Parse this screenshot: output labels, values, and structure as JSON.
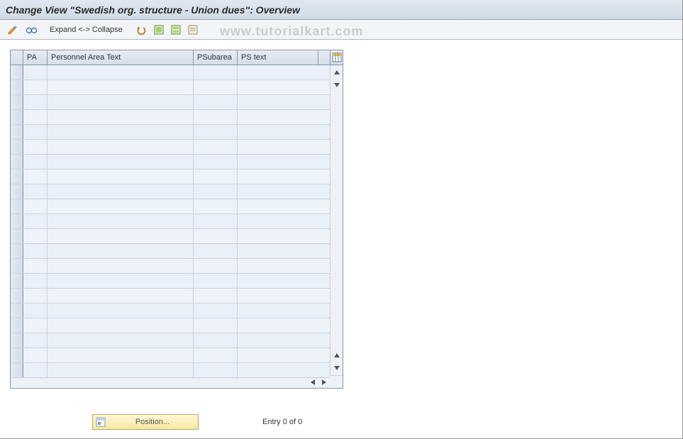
{
  "title": "Change View \"Swedish org. structure - Union dues\": Overview",
  "toolbar": {
    "expand_collapse": "Expand <-> Collapse"
  },
  "watermark": "www.tutorialkart.com",
  "table": {
    "columns": {
      "pa": "PA",
      "pat": "Personnel Area Text",
      "psa": "PSubarea",
      "pst": "PS text"
    },
    "row_count": 21
  },
  "footer": {
    "position_label": "Position...",
    "entry_text": "Entry 0 of 0"
  }
}
